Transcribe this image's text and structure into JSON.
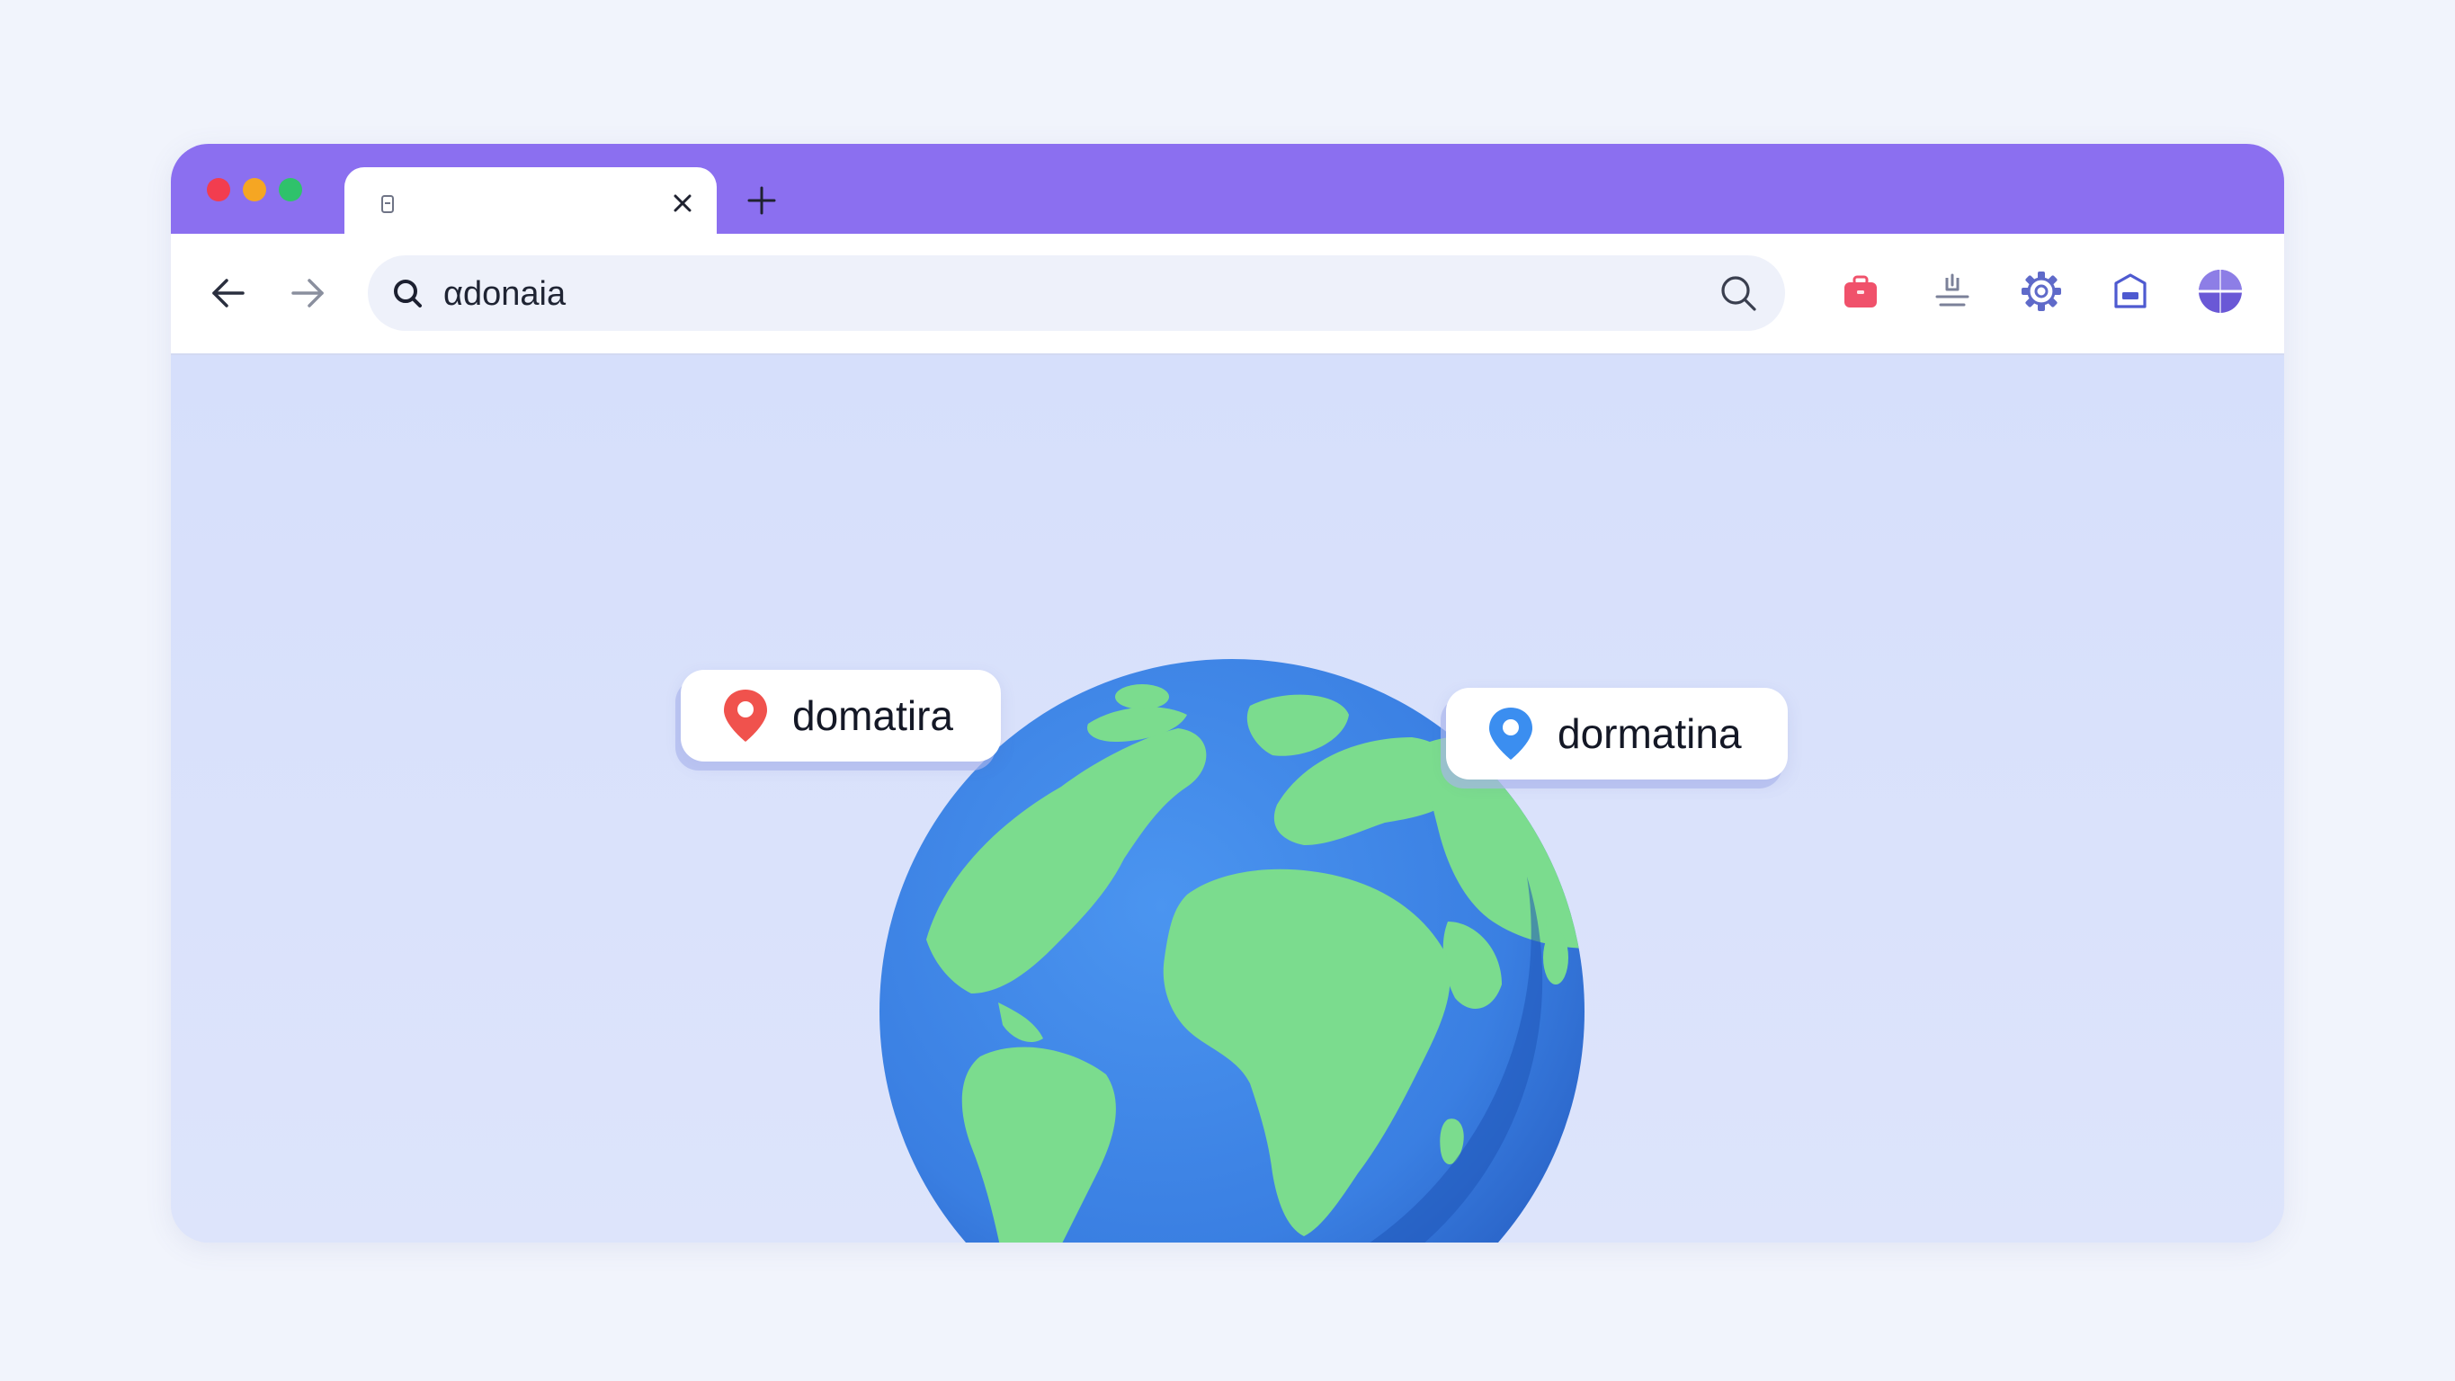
{
  "window": {
    "traffic_lights": {
      "close_color": "#f23d4f",
      "minimize_color": "#f5a623",
      "maximize_color": "#2fc26b"
    },
    "titlebar_color": "#8b6ff0"
  },
  "tab": {
    "title": "",
    "icon": "page-icon",
    "close_icon": "close-icon"
  },
  "new_tab": {
    "icon": "plus-icon"
  },
  "toolbar": {
    "back_icon": "arrow-left-icon",
    "forward_icon": "arrow-right-icon",
    "address": {
      "value": "αdonaia",
      "placeholder": "",
      "lead_icon": "search-icon",
      "trailing_icon": "search-icon"
    },
    "tools": [
      {
        "name": "briefcase-icon",
        "color": "#f0516b"
      },
      {
        "name": "download-icon",
        "color": "#7b8199"
      },
      {
        "name": "gear-icon",
        "color": "#5f6ac9"
      },
      {
        "name": "archive-icon",
        "color": "#4e5ad0"
      },
      {
        "name": "avatar-globe-icon",
        "color": "#6a58d6"
      }
    ]
  },
  "content": {
    "globe": {
      "ocean_color": "#3f86e6",
      "land_color": "#7bdc8e"
    },
    "pins": [
      {
        "label": "domatira",
        "pin_color": "#f0524d"
      },
      {
        "label": "dormatina",
        "pin_color": "#3b8ef0"
      }
    ]
  }
}
